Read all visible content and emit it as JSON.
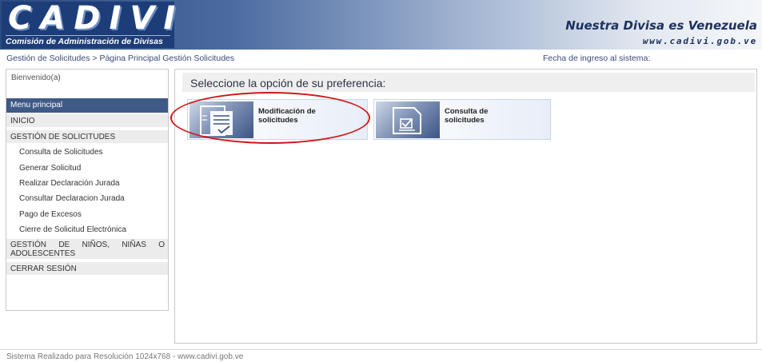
{
  "header": {
    "logo_text": "CADIVI",
    "logo_subtitle": "Comisión de Administración de Divisas",
    "slogan": "Nuestra Divisa es Venezuela",
    "site_url": "www.cadivi.gob.ve"
  },
  "breadcrumb": "Gestión de Solicitudes > Página Principal Gestión Solicitudes",
  "entry_date_label": "Fecha de ingreso al sistema:",
  "sidebar": {
    "welcome": "Bienvenido(a)",
    "menu_title": "Menu principal",
    "inicio": "INICIO",
    "gestion": "GESTIÓN DE SOLICITUDES",
    "items": [
      {
        "label": "Consulta de Solicitudes"
      },
      {
        "label": "Generar Solicitud"
      },
      {
        "label": "Realizar Declaración Jurada"
      },
      {
        "label": "Consultar Declaracion Jurada"
      },
      {
        "label": "Pago de Excesos"
      },
      {
        "label": "Cierre de Solicitud Electrónica"
      }
    ],
    "ninos": "GESTIÓN DE NIÑOS, NIÑAS O ADOLESCENTES",
    "cerrar": "CERRAR SESIÓN"
  },
  "main": {
    "title": "Seleccione la opción de su preferencia:",
    "options": [
      {
        "label": "Modificación de solicitudes",
        "icon": "document-edit-icon"
      },
      {
        "label": "Consulta de solicitudes",
        "icon": "checkbox-document-icon"
      }
    ]
  },
  "footer": "Sistema Realizado para Resolución 1024x768 - www.cadivi.gob.ve",
  "colors": {
    "brand_blue": "#1d3d78",
    "menu_blue": "#3f5a86",
    "highlight_red": "#d01818"
  }
}
